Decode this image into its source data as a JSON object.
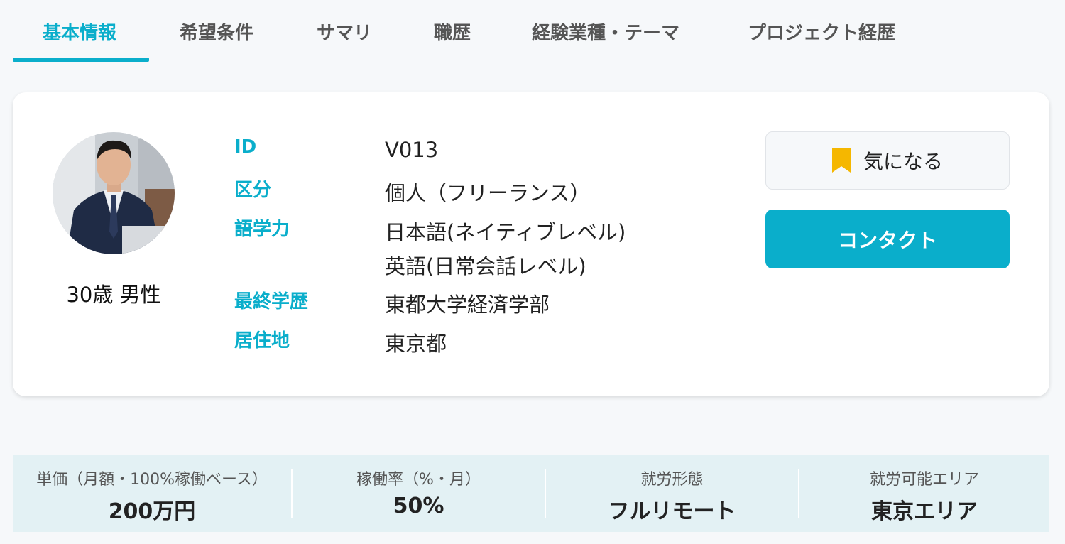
{
  "tabs": [
    {
      "label": "基本情報",
      "active": true
    },
    {
      "label": "希望条件"
    },
    {
      "label": "サマリ"
    },
    {
      "label": "職歴"
    },
    {
      "label": "経験業種・テーマ"
    },
    {
      "label": "プロジェクト経歴"
    }
  ],
  "profile": {
    "summary": "30歳 男性",
    "avatar_icon": "person-photo"
  },
  "info": {
    "id_label": "ID",
    "id_value": "V013",
    "type_label": "区分",
    "type_value": "個人（フリーランス）",
    "language_label": "語学力",
    "language_values": [
      "日本語(ネイティブレベル)",
      "英語(日常会話レベル)"
    ],
    "education_label": "最終学歴",
    "education_value": "東都大学経済学部",
    "residence_label": "居住地",
    "residence_value": "東京都"
  },
  "actions": {
    "favorite_label": "気になる",
    "favorite_icon": "bookmark-icon",
    "contact_label": "コンタクト"
  },
  "stats": [
    {
      "label": "単価（月額・100%稼働ベース）",
      "value": "200万円"
    },
    {
      "label": "稼働率（%・月）",
      "value": "50%"
    },
    {
      "label": "就労形態",
      "value": "フルリモート"
    },
    {
      "label": "就労可能エリア",
      "value": "東京エリア"
    }
  ],
  "colors": {
    "accent": "#0aaecb",
    "bookmark": "#f5b700",
    "stats_bg": "#e3f1f4"
  }
}
